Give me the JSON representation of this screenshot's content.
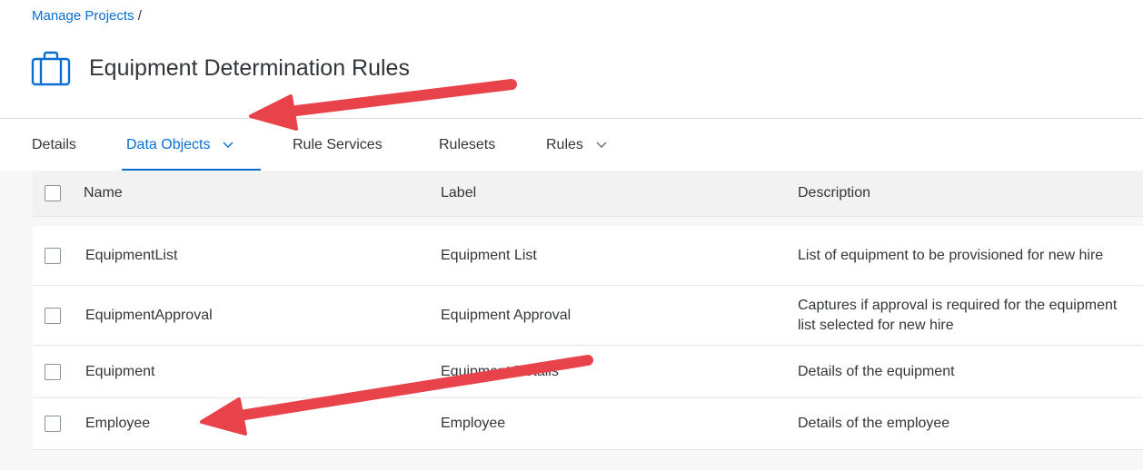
{
  "breadcrumb": {
    "link": "Manage Projects",
    "separator": "/"
  },
  "header": {
    "title": "Equipment Determination Rules",
    "icon": "briefcase-icon"
  },
  "tabs": [
    {
      "label": "Details",
      "selected": false,
      "has_dropdown": false
    },
    {
      "label": "Data Objects",
      "selected": true,
      "has_dropdown": true
    },
    {
      "label": "Rule Services",
      "selected": false,
      "has_dropdown": false
    },
    {
      "label": "Rulesets",
      "selected": false,
      "has_dropdown": false
    },
    {
      "label": "Rules",
      "selected": false,
      "has_dropdown": true
    }
  ],
  "table": {
    "columns": [
      "Name",
      "Label",
      "Description"
    ],
    "rows": [
      {
        "name": "EquipmentList",
        "label": "Equipment List",
        "description": "List of equipment to be provisioned for new hire"
      },
      {
        "name": "EquipmentApproval",
        "label": "Equipment Approval",
        "description": "Captures if approval is required for the equipment list selected for new hire"
      },
      {
        "name": "Equipment",
        "label": "Equipment Details",
        "description": "Details of the equipment"
      },
      {
        "name": "Employee",
        "label": "Employee",
        "description": "Details of the employee"
      }
    ]
  },
  "colors": {
    "accent": "#0a6ed1",
    "text": "#32363a",
    "annotation_arrow": "#e8424a"
  }
}
